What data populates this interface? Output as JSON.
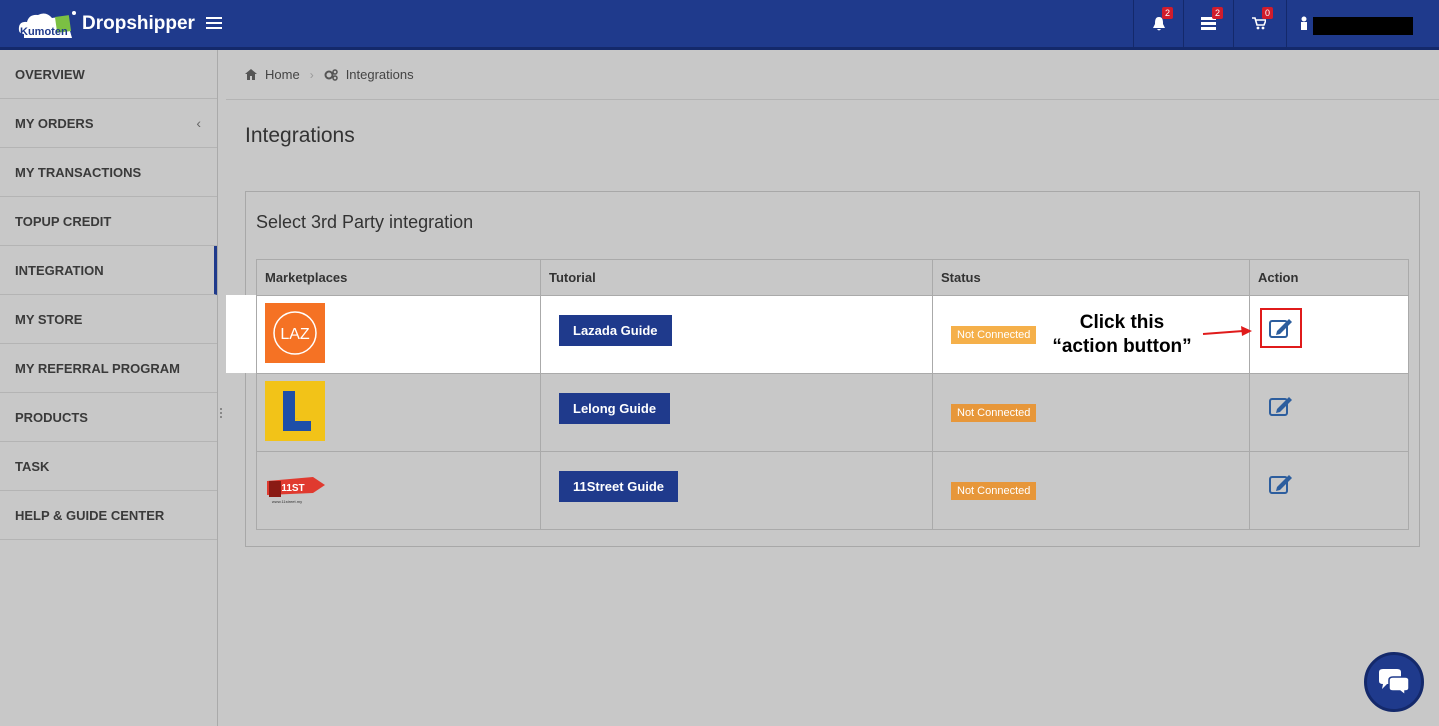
{
  "brand": {
    "logo_text": "Kumoten",
    "name": "Dropshipper"
  },
  "topbar": {
    "notifications": {
      "icon": "bell-icon",
      "count": "2"
    },
    "messages": {
      "icon": "message-list-icon",
      "count": "2"
    },
    "cart": {
      "icon": "cart-icon",
      "count": "0"
    }
  },
  "sidebar": {
    "items": [
      {
        "label": "OVERVIEW"
      },
      {
        "label": "MY ORDERS",
        "chevron": "‹"
      },
      {
        "label": "MY TRANSACTIONS"
      },
      {
        "label": "TOPUP CREDIT"
      },
      {
        "label": "INTEGRATION",
        "active": true
      },
      {
        "label": "MY STORE"
      },
      {
        "label": "MY REFERRAL PROGRAM"
      },
      {
        "label": "PRODUCTS"
      },
      {
        "label": "TASK"
      },
      {
        "label": "HELP & GUIDE CENTER"
      }
    ]
  },
  "breadcrumb": {
    "home": "Home",
    "current": "Integrations"
  },
  "page": {
    "title": "Integrations"
  },
  "panel": {
    "title": "Select 3rd Party integration"
  },
  "table": {
    "headers": [
      "Marketplaces",
      "Tutorial",
      "Status",
      "Action"
    ],
    "rows": [
      {
        "marketplace": "LAZ",
        "guide": "Lazada Guide",
        "status": "Not Connected"
      },
      {
        "marketplace": "L",
        "guide": "Lelong Guide",
        "status": "Not Connected"
      },
      {
        "marketplace": "11ST",
        "marketplace_sub": "www.11street.my",
        "guide": "11Street Guide",
        "status": "Not Connected"
      }
    ]
  },
  "callout": {
    "line1": "Click this",
    "line2": "“action button”"
  },
  "colors": {
    "primary": "#1f3a8c",
    "status": "#e7973a",
    "highlight": "#e01b1b"
  }
}
